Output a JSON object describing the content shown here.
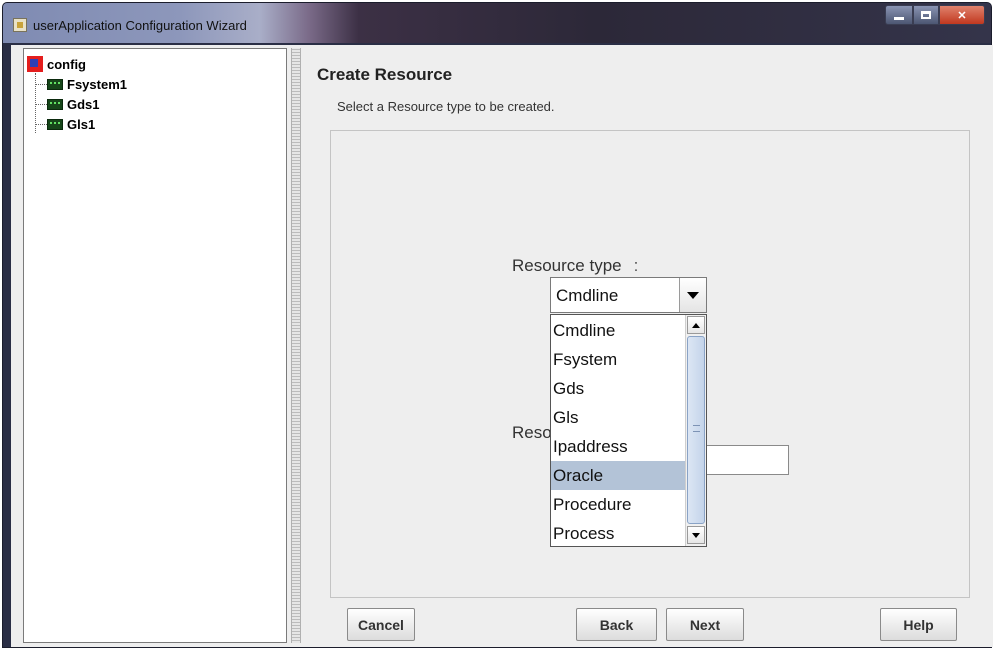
{
  "window": {
    "title": "userApplication Configuration Wizard"
  },
  "tree": {
    "root": "config",
    "children": [
      "Fsystem1",
      "Gds1",
      "Gls1"
    ]
  },
  "page": {
    "title": "Create Resource",
    "description": "Select a Resource type to be created."
  },
  "form": {
    "resource_type_label": "Resource type",
    "resource_type_colon": ":",
    "resource_name_label_partial": "Reso",
    "selected_type": "Cmdline",
    "name_value": ""
  },
  "dropdown": {
    "options": [
      "Cmdline",
      "Fsystem",
      "Gds",
      "Gls",
      "Ipaddress",
      "Oracle",
      "Procedure",
      "Process"
    ],
    "highlighted": "Oracle"
  },
  "buttons": {
    "cancel": "Cancel",
    "back": "Back",
    "next": "Next",
    "help": "Help"
  },
  "colors": {
    "highlight": "#b3c3d7",
    "background": "#eeeeee"
  }
}
